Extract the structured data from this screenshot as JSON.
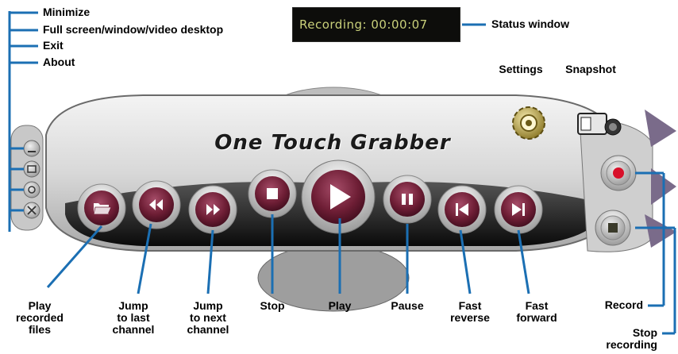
{
  "status": {
    "text": "Recording: 00:00:07"
  },
  "app": {
    "title": "One Touch Grabber"
  },
  "callouts": {
    "minimize": "Minimize",
    "fullscreen": "Full screen/window/video desktop",
    "exit": "Exit",
    "about": "About",
    "status_window": "Status window",
    "settings": "Settings",
    "snapshot": "Snapshot",
    "play_recorded": [
      "Play",
      "recorded",
      "files"
    ],
    "jump_last": [
      "Jump",
      "to last",
      "channel"
    ],
    "jump_next": [
      "Jump",
      "to next",
      "channel"
    ],
    "stop": "Stop",
    "play": "Play",
    "pause": "Pause",
    "fast_reverse": [
      "Fast",
      "reverse"
    ],
    "fast_forward": [
      "Fast",
      "forward"
    ],
    "record": "Record",
    "stop_recording": [
      "Stop",
      "recording"
    ]
  },
  "colors": {
    "callout_line": "#1b6fb3",
    "button_maroon": "#6e1e35",
    "panel": "#e4e4e4"
  },
  "icons": {
    "play_recorded": "folder-open-icon",
    "jump_last": "rewind-icon",
    "jump_next": "fast-forward-icon",
    "stop": "stop-square-icon",
    "play": "play-triangle-icon",
    "pause": "pause-icon",
    "fast_reverse": "skip-back-icon",
    "fast_forward": "skip-forward-icon",
    "settings": "gear-icon",
    "snapshot": "camera-icon"
  }
}
